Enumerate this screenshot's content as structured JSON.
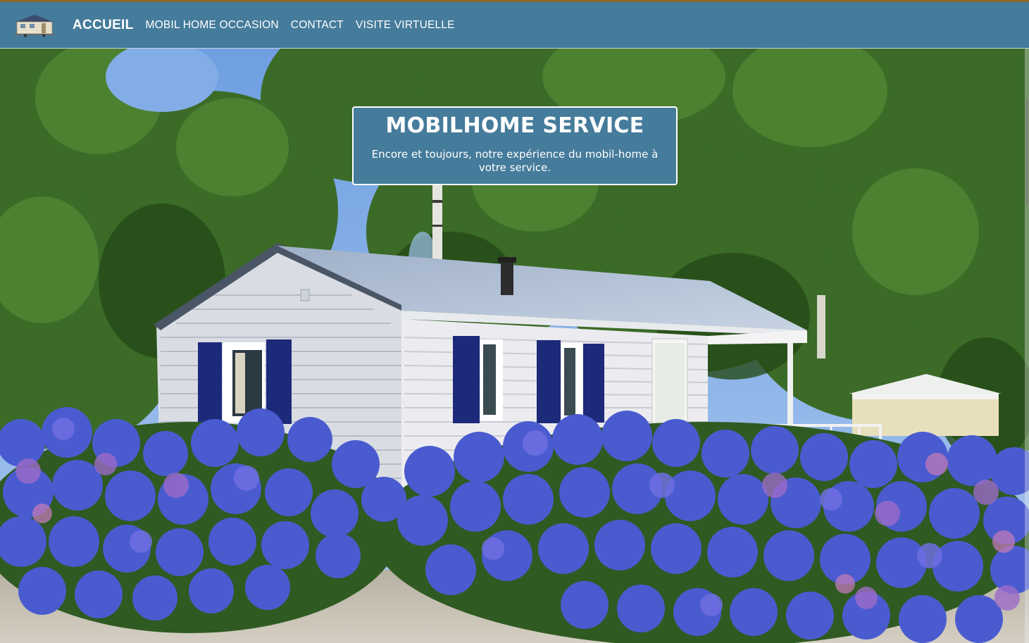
{
  "nav": {
    "home_label": "ACCUEIL",
    "links": [
      {
        "label": "MOBIL HOME OCCASION"
      },
      {
        "label": "CONTACT"
      },
      {
        "label": "VISITE VIRTUELLE"
      }
    ],
    "logo_icon": "mobile-home-logo-icon"
  },
  "banner": {
    "title": "MOBILHOME SERVICE",
    "subtitle": "Encore et toujours, notre expérience du mobil-home à votre service."
  },
  "theme": {
    "nav_color": "#457b9b",
    "banner_color": "#457b9b",
    "text_color": "#ffffff"
  }
}
